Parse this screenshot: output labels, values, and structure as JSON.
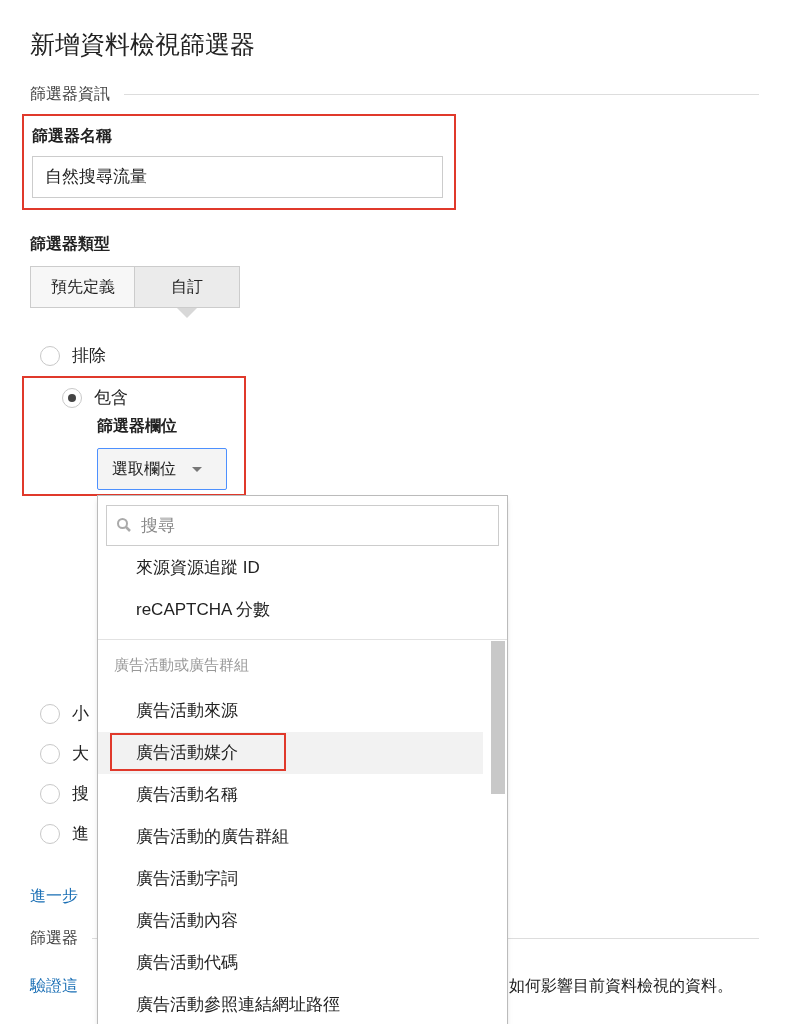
{
  "title": "新增資料檢視篩選器",
  "section": "篩選器資訊",
  "name_field": {
    "label": "篩選器名稱",
    "value": "自然搜尋流量",
    "highlighted": true
  },
  "type": {
    "label": "篩選器類型",
    "tabs": [
      {
        "label": "預先定義",
        "selected": false
      },
      {
        "label": "自訂",
        "selected": true
      }
    ]
  },
  "options": [
    {
      "label": "排除",
      "selected": false
    },
    {
      "label": "包含",
      "selected": true,
      "highlighted": true,
      "field_label": "篩選器欄位",
      "field_button": "選取欄位"
    },
    {
      "label": "小",
      "selected": false
    },
    {
      "label": "大",
      "selected": false
    },
    {
      "label": "搜",
      "selected": false
    },
    {
      "label": "進",
      "selected": false
    }
  ],
  "learn_more_link": "進一步",
  "verify_heading": "篩選器",
  "verify": {
    "link": "驗證這",
    "text": "如何影響目前資料檢視的資料。"
  },
  "dropdown": {
    "search_placeholder": "搜尋",
    "items": [
      {
        "kind": "item",
        "label": "來源資源追蹤 ID",
        "selected": false
      },
      {
        "kind": "item",
        "label": "reCAPTCHA 分數",
        "selected": false
      },
      {
        "kind": "group",
        "label": "廣告活動或廣告群組"
      },
      {
        "kind": "item",
        "label": "廣告活動來源",
        "selected": false
      },
      {
        "kind": "item",
        "label": "廣告活動媒介",
        "selected": true
      },
      {
        "kind": "item",
        "label": "廣告活動名稱",
        "selected": false
      },
      {
        "kind": "item",
        "label": "廣告活動的廣告群組",
        "selected": false
      },
      {
        "kind": "item",
        "label": "廣告活動字詞",
        "selected": false
      },
      {
        "kind": "item",
        "label": "廣告活動內容",
        "selected": false
      },
      {
        "kind": "item",
        "label": "廣告活動代碼",
        "selected": false
      },
      {
        "kind": "item",
        "label": "廣告活動參照連結網址路徑",
        "selected": false
      }
    ]
  }
}
